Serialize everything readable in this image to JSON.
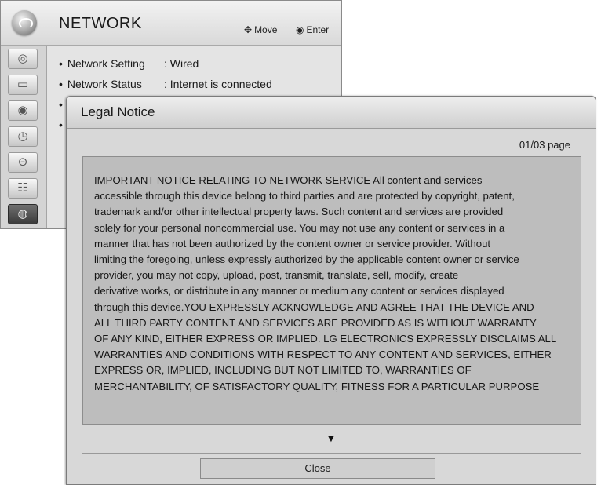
{
  "menu": {
    "title": "NETWORK",
    "hint_move": "Move",
    "hint_enter": "Enter",
    "sidebar_icons": [
      "picture-icon",
      "screen-icon",
      "audio-icon",
      "time-icon",
      "lock-icon",
      "option-icon",
      "network-icon"
    ],
    "rows": [
      {
        "label": "Network Setting",
        "value": ": Wired"
      },
      {
        "label": "Network Status",
        "value": ": Internet is connected"
      }
    ],
    "bullet": "•"
  },
  "dialog": {
    "title": "Legal Notice",
    "page": "01/03 page",
    "notice_lines": [
      "IMPORTANT NOTICE RELATING TO NETWORK SERVICE All content and services",
      "accessible through this device belong to third parties and are protected by copyright, patent,",
      "trademark and/or other intellectual property laws. Such content and services are provided",
      "solely for your personal noncommercial use. You may not use any content or services in a",
      "manner that has not been authorized by the content owner or service provider. Without",
      "limiting the foregoing, unless expressly authorized by the applicable content owner or service",
      "provider, you may not copy, upload, post, transmit, translate, sell, modify, create",
      "derivative works, or distribute in any manner or medium any content or services displayed",
      "through this device.YOU EXPRESSLY ACKNOWLEDGE AND AGREE THAT THE DEVICE AND",
      "ALL THIRD PARTY CONTENT AND SERVICES ARE PROVIDED AS IS WITHOUT WARRANTY",
      "OF ANY KIND, EITHER EXPRESS OR IMPLIED. LG ELECTRONICS EXPRESSLY DISCLAIMS ALL",
      "WARRANTIES AND CONDITIONS WITH RESPECT TO ANY CONTENT AND SERVICES, EITHER",
      "EXPRESS OR, IMPLIED, INCLUDING BUT NOT LIMITED TO, WARRANTIES OF",
      "MERCHANTABILITY, OF SATISFACTORY QUALITY, FITNESS FOR A PARTICULAR PURPOSE"
    ],
    "close_label": "Close"
  }
}
